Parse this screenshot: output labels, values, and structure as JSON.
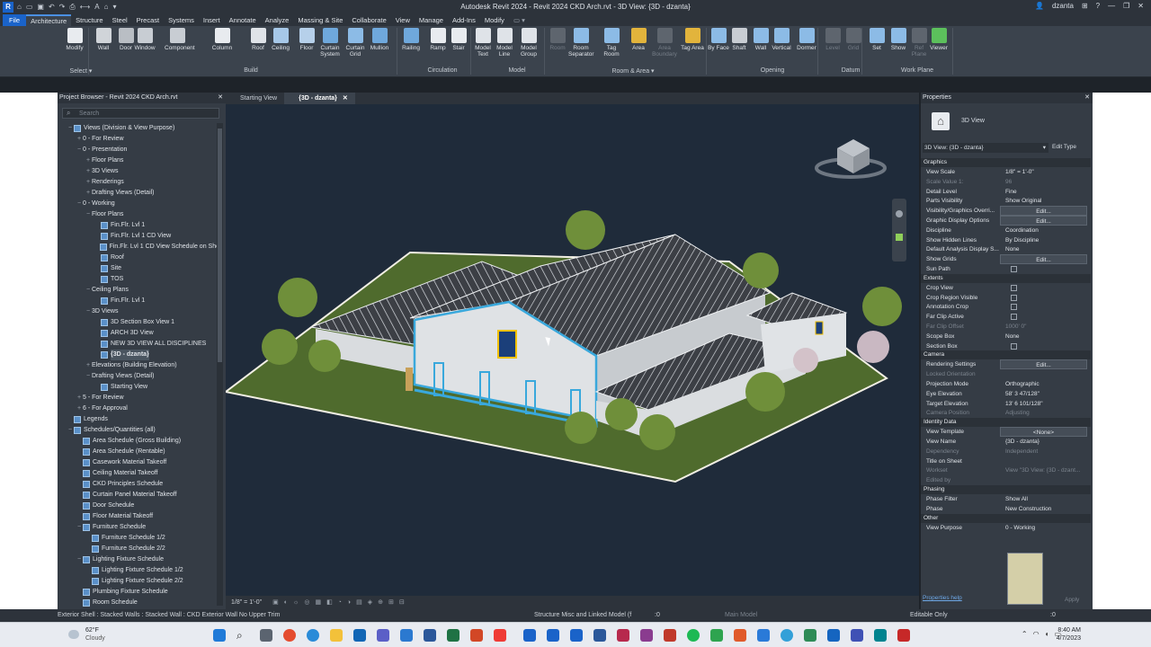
{
  "title_bar": {
    "app_icon": "R",
    "window_title": "Autodesk Revit 2024 - Revit 2024 CKD Arch.rvt - 3D View: {3D - dzanta}",
    "user": "dzanta",
    "help": "?"
  },
  "ribbon_tabs": [
    "File",
    "Architecture",
    "Structure",
    "Steel",
    "Precast",
    "Systems",
    "Insert",
    "Annotate",
    "Analyze",
    "Massing & Site",
    "Collaborate",
    "View",
    "Manage",
    "Add-Ins",
    "Modify"
  ],
  "ribbon_buttons": {
    "modify": "Modify",
    "wall": "Wall",
    "door": "Door",
    "window": "Window",
    "component": "Component",
    "column": "Column",
    "roof": "Roof",
    "ceiling": "Ceiling",
    "floor": "Floor",
    "curtain_system": "Curtain System",
    "curtain_grid": "Curtain Grid",
    "mullion": "Mullion",
    "railing": "Railing",
    "ramp": "Ramp",
    "stair": "Stair",
    "model_text": "Model Text",
    "model_line": "Model Line",
    "model_group": "Model Group",
    "room": "Room",
    "room_separator": "Room Separator",
    "tag_room": "Tag Room",
    "area": "Area",
    "area_boundary": "Area Boundary",
    "tag_area": "Tag Area",
    "by_face": "By Face",
    "shaft": "Shaft",
    "wall_opening": "Wall",
    "vertical": "Vertical",
    "dormer": "Dormer",
    "level": "Level",
    "grid": "Grid",
    "set": "Set",
    "show": "Show",
    "ref_plane": "Ref Plane",
    "viewer": "Viewer"
  },
  "ribbon_panels": {
    "select": "Select ▾",
    "build": "Build",
    "circulation": "Circulation",
    "model": "Model",
    "room_area": "Room & Area ▾",
    "opening": "Opening",
    "datum": "Datum",
    "work_plane": "Work Plane"
  },
  "project_browser": {
    "title": "Project Browser - Revit 2024 CKD Arch.rvt",
    "search_placeholder": "Search",
    "items": [
      {
        "toggle": "−",
        "label": "Views (Division & View Purpose)",
        "indent": 0,
        "icon": true
      },
      {
        "toggle": "+",
        "label": "0 - For Review",
        "indent": 1
      },
      {
        "toggle": "−",
        "label": "0 - Presentation",
        "indent": 1
      },
      {
        "toggle": "+",
        "label": "Floor Plans",
        "indent": 2
      },
      {
        "toggle": "+",
        "label": "3D Views",
        "indent": 2
      },
      {
        "toggle": "+",
        "label": "Renderings",
        "indent": 2
      },
      {
        "toggle": "+",
        "label": "Drafting Views (Detail)",
        "indent": 2
      },
      {
        "toggle": "−",
        "label": "0 - Working",
        "indent": 1
      },
      {
        "toggle": "−",
        "label": "Floor Plans",
        "indent": 2
      },
      {
        "toggle": "",
        "label": "Fin.Flr. Lvl 1",
        "indent": 3,
        "icon": true
      },
      {
        "toggle": "",
        "label": "Fin.Flr. Lvl 1 CD View",
        "indent": 3,
        "icon": true
      },
      {
        "toggle": "",
        "label": "Fin.Flr. Lvl 1 CD View Schedule on She",
        "indent": 3,
        "icon": true
      },
      {
        "toggle": "",
        "label": "Roof",
        "indent": 3,
        "icon": true
      },
      {
        "toggle": "",
        "label": "Site",
        "indent": 3,
        "icon": true
      },
      {
        "toggle": "",
        "label": "TOS",
        "indent": 3,
        "icon": true
      },
      {
        "toggle": "−",
        "label": "Ceiling Plans",
        "indent": 2
      },
      {
        "toggle": "",
        "label": "Fin.Flr. Lvl 1",
        "indent": 3,
        "icon": true
      },
      {
        "toggle": "−",
        "label": "3D Views",
        "indent": 2
      },
      {
        "toggle": "",
        "label": "3D Section Box View 1",
        "indent": 3,
        "icon": true
      },
      {
        "toggle": "",
        "label": "ARCH 3D View",
        "indent": 3,
        "icon": true
      },
      {
        "toggle": "",
        "label": "NEW 3D VIEW ALL DISCIPLINES",
        "indent": 3,
        "icon": true
      },
      {
        "toggle": "",
        "label": "{3D - dzanta}",
        "indent": 3,
        "icon": true,
        "selected": true
      },
      {
        "toggle": "+",
        "label": "Elevations (Building Elevation)",
        "indent": 2
      },
      {
        "toggle": "−",
        "label": "Drafting Views (Detail)",
        "indent": 2
      },
      {
        "toggle": "",
        "label": "Starting View",
        "indent": 3,
        "icon": true
      },
      {
        "toggle": "+",
        "label": "5 - For Review",
        "indent": 1
      },
      {
        "toggle": "+",
        "label": "6 - For Approval",
        "indent": 1
      },
      {
        "toggle": "",
        "label": "Legends",
        "indent": 0,
        "icon": true
      },
      {
        "toggle": "−",
        "label": "Schedules/Quantities (all)",
        "indent": 0,
        "icon": true
      },
      {
        "toggle": "",
        "label": "Area Schedule (Gross Building)",
        "indent": 1,
        "icon": true
      },
      {
        "toggle": "",
        "label": "Area Schedule (Rentable)",
        "indent": 1,
        "icon": true
      },
      {
        "toggle": "",
        "label": "Casework Material Takeoff",
        "indent": 1,
        "icon": true
      },
      {
        "toggle": "",
        "label": "Ceiling Material Takeoff",
        "indent": 1,
        "icon": true
      },
      {
        "toggle": "",
        "label": "CKD Principles Schedule",
        "indent": 1,
        "icon": true
      },
      {
        "toggle": "",
        "label": "Curtain Panel Material Takeoff",
        "indent": 1,
        "icon": true
      },
      {
        "toggle": "",
        "label": "Door Schedule",
        "indent": 1,
        "icon": true
      },
      {
        "toggle": "",
        "label": "Floor Material Takeoff",
        "indent": 1,
        "icon": true
      },
      {
        "toggle": "−",
        "label": "Furniture Schedule",
        "indent": 1,
        "icon": true
      },
      {
        "toggle": "",
        "label": "Furniture Schedule 1/2",
        "indent": 2,
        "icon": true
      },
      {
        "toggle": "",
        "label": "Furniture Schedule 2/2",
        "indent": 2,
        "icon": true
      },
      {
        "toggle": "−",
        "label": "Lighting Fixture Schedule",
        "indent": 1,
        "icon": true
      },
      {
        "toggle": "",
        "label": "Lighting Fixture Schedule 1/2",
        "indent": 2,
        "icon": true
      },
      {
        "toggle": "",
        "label": "Lighting Fixture Schedule 2/2",
        "indent": 2,
        "icon": true
      },
      {
        "toggle": "",
        "label": "Plumbing Fixture Schedule",
        "indent": 1,
        "icon": true
      },
      {
        "toggle": "",
        "label": "Room Schedule",
        "indent": 1,
        "icon": true
      }
    ]
  },
  "view_tabs": [
    {
      "label": "Starting View",
      "active": false
    },
    {
      "label": "{3D - dzanta}",
      "active": true
    }
  ],
  "view_control_bar": {
    "scale": "1/8\" = 1'-0\""
  },
  "properties": {
    "title": "Properties",
    "type_name": "3D View",
    "selector": "3D View: {3D - dzanta}",
    "edit_type": "Edit Type",
    "groups": [
      {
        "name": "Graphics",
        "rows": [
          {
            "k": "View Scale",
            "v": "1/8\" = 1'-0\""
          },
          {
            "k": "Scale Value 1:",
            "v": "96",
            "dim": true
          },
          {
            "k": "Detail Level",
            "v": "Fine"
          },
          {
            "k": "Parts Visibility",
            "v": "Show Original"
          },
          {
            "k": "Visibility/Graphics Overri...",
            "v": "Edit...",
            "btn": true
          },
          {
            "k": "Graphic Display Options",
            "v": "Edit...",
            "btn": true
          },
          {
            "k": "Discipline",
            "v": "Coordination"
          },
          {
            "k": "Show Hidden Lines",
            "v": "By Discipline"
          },
          {
            "k": "Default Analysis Display S...",
            "v": "None"
          },
          {
            "k": "Show Grids",
            "v": "Edit...",
            "btn": true
          },
          {
            "k": "Sun Path",
            "v": "",
            "cb": true
          }
        ]
      },
      {
        "name": "Extents",
        "rows": [
          {
            "k": "Crop View",
            "v": "",
            "cb": true
          },
          {
            "k": "Crop Region Visible",
            "v": "",
            "cb": true
          },
          {
            "k": "Annotation Crop",
            "v": "",
            "cb": true
          },
          {
            "k": "Far Clip Active",
            "v": "",
            "cb": true
          },
          {
            "k": "Far Clip Offset",
            "v": "1000' 0\"",
            "dim": true
          },
          {
            "k": "Scope Box",
            "v": "None"
          },
          {
            "k": "Section Box",
            "v": "",
            "cb": true
          }
        ]
      },
      {
        "name": "Camera",
        "rows": [
          {
            "k": "Rendering Settings",
            "v": "Edit...",
            "btn": true
          },
          {
            "k": "Locked Orientation",
            "v": "",
            "dim": true
          },
          {
            "k": "Projection Mode",
            "v": "Orthographic"
          },
          {
            "k": "Eye Elevation",
            "v": "58' 3 47/128\""
          },
          {
            "k": "Target Elevation",
            "v": "13' 6 101/128\""
          },
          {
            "k": "Camera Position",
            "v": "Adjusting",
            "dim": true
          }
        ]
      },
      {
        "name": "Identity Data",
        "rows": [
          {
            "k": "View Template",
            "v": "<None>",
            "btn": true
          },
          {
            "k": "View Name",
            "v": "{3D - dzanta}"
          },
          {
            "k": "Dependency",
            "v": "Independent",
            "dim": true
          },
          {
            "k": "Title on Sheet",
            "v": ""
          },
          {
            "k": "Workset",
            "v": "View \"3D View: {3D - dzant...",
            "dim": true
          },
          {
            "k": "Edited by",
            "v": "",
            "dim": true
          }
        ]
      },
      {
        "name": "Phasing",
        "rows": [
          {
            "k": "Phase Filter",
            "v": "Show All"
          },
          {
            "k": "Phase",
            "v": "New Construction"
          }
        ]
      },
      {
        "name": "Other",
        "rows": [
          {
            "k": "View Purpose",
            "v": "0 - Working"
          }
        ]
      }
    ],
    "help_link": "Properties help",
    "apply": "Apply"
  },
  "status_bar": {
    "left": "Exterior Shell : Stacked Walls : Stacked Wall : CKD Exterior Wall No Upper Trim",
    "workset": "Structure Misc and Linked Model (f",
    "count": ":0",
    "main_model": "Main Model",
    "editable": "Editable Only",
    "filter": ":0"
  },
  "taskbar": {
    "temp": "62°F",
    "weather": "Cloudy",
    "time": "8:40 AM",
    "date": "4/7/2023"
  }
}
